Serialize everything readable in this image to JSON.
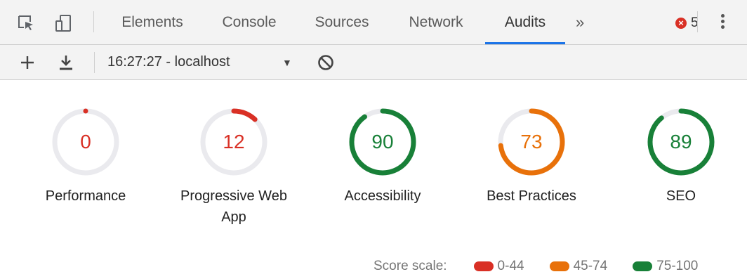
{
  "tabs": [
    {
      "label": "Elements",
      "active": false
    },
    {
      "label": "Console",
      "active": false
    },
    {
      "label": "Sources",
      "active": false
    },
    {
      "label": "Network",
      "active": false
    },
    {
      "label": "Audits",
      "active": true
    }
  ],
  "more_tabs_label": "»",
  "error_count": "5",
  "toolbar": {
    "run_label": "16:27:27 - localhost"
  },
  "categories": [
    {
      "label": "Performance",
      "score": 0,
      "score_text": "0",
      "color": "#d93025"
    },
    {
      "label": "Progressive Web App",
      "score": 12,
      "score_text": "12",
      "color": "#d93025"
    },
    {
      "label": "Accessibility",
      "score": 90,
      "score_text": "90",
      "color": "#188038"
    },
    {
      "label": "Best Practices",
      "score": 73,
      "score_text": "73",
      "color": "#e8710a"
    },
    {
      "label": "SEO",
      "score": 89,
      "score_text": "89",
      "color": "#188038"
    }
  ],
  "score_scale": {
    "label": "Score scale:",
    "ranges": [
      {
        "label": "0-44",
        "color": "#d93025"
      },
      {
        "label": "45-74",
        "color": "#e8710a"
      },
      {
        "label": "75-100",
        "color": "#188038"
      }
    ]
  },
  "colors": {
    "tab_active_underline": "#1a73e8",
    "gauge_track": "#eaeaee"
  }
}
